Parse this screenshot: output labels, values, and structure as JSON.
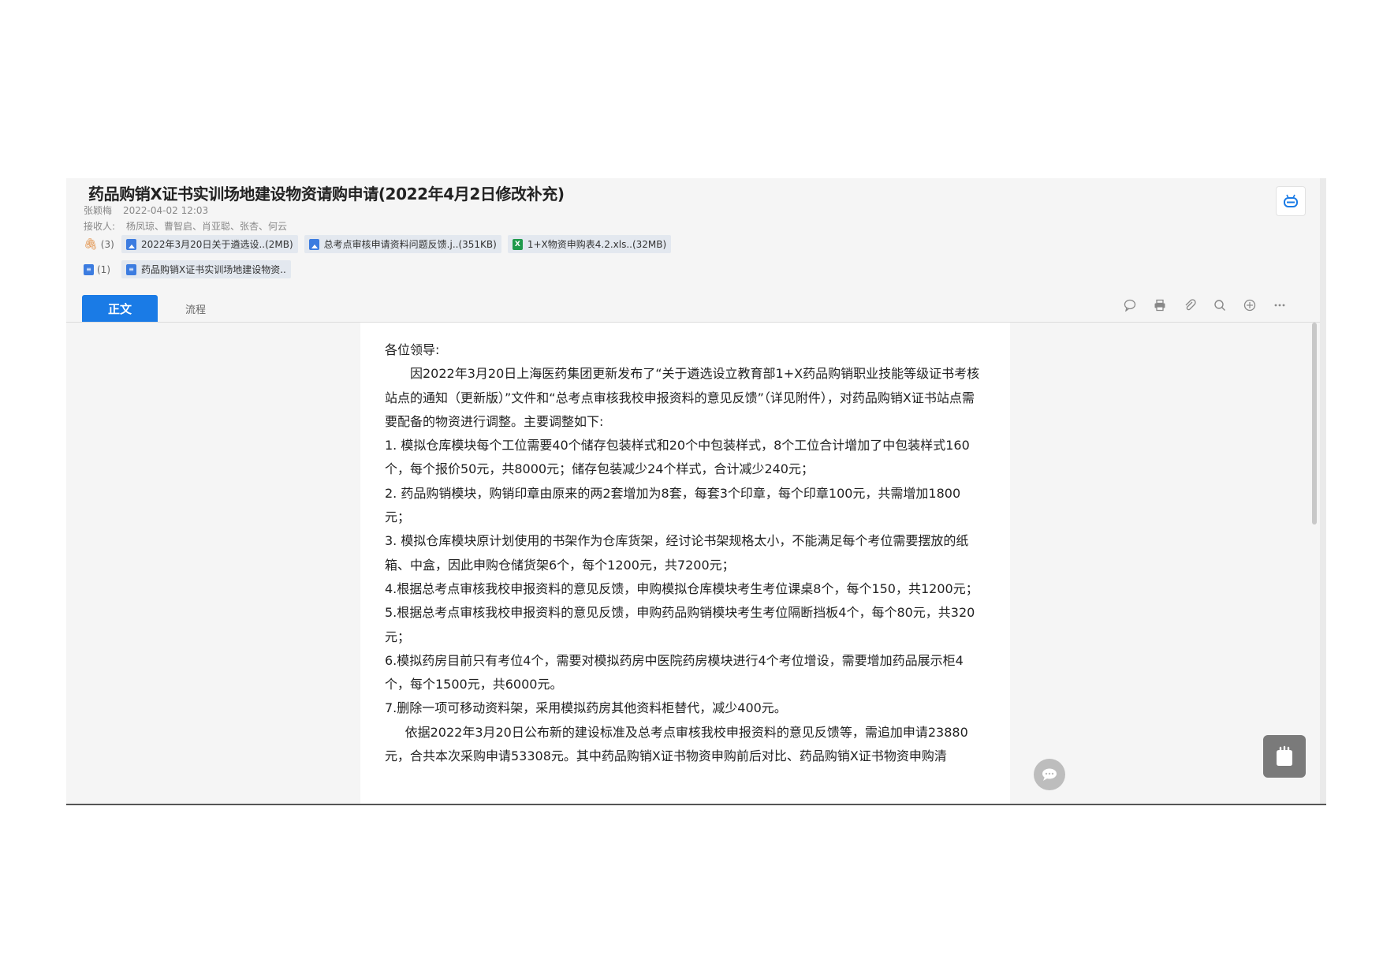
{
  "doc": {
    "title": "药品购销X证书实训场地建设物资请购申请(2022年4月2日修改补充)",
    "author": "张颖梅",
    "datetime": "2022-04-02 12:03",
    "recipients_label": "接收人:",
    "recipients": "杨凤琼、曹智启、肖亚聪、张杏、何云"
  },
  "attachments": {
    "count": "(3)",
    "items": [
      {
        "name": "2022年3月20日关于遴选设..(2MB)",
        "icon": "image-file-icon"
      },
      {
        "name": "总考点审核申请资料问题反馈.j..(351KB)",
        "icon": "image-file-icon"
      },
      {
        "name": "1+X物资申购表4.2.xls..(32MB)",
        "icon": "excel-file-icon"
      }
    ]
  },
  "related": {
    "count": "(1)",
    "items": [
      {
        "name": "药品购销X证书实训场地建设物资..",
        "icon": "form-doc-icon"
      }
    ]
  },
  "tabs": [
    {
      "label": "正文",
      "active": true
    },
    {
      "label": "流程",
      "active": false
    }
  ],
  "toolbar": [
    "comment-icon",
    "print-icon",
    "attachment-icon",
    "search-icon",
    "translate-icon",
    "more-icon"
  ],
  "body": {
    "greeting": "各位领导:",
    "p1": "因2022年3月20日上海医药集团更新发布了“关于遴选设立教育部1+X药品购销职业技能等级证书考核站点的通知（更新版）”文件和“总考点审核我校申报资料的意见反馈”（详见附件），对药品购销X证书站点需要配备的物资进行调整。主要调整如下:",
    "items": [
      "1. 模拟仓库模块每个工位需要40个储存包装样式和20个中包装样式，8个工位合计增加了中包装样式160个，每个报价50元，共8000元；储存包装减少24个样式，合计减少240元；",
      "2. 药品购销模块，购销印章由原来的两2套增加为8套，每套3个印章，每个印章100元，共需增加1800元；",
      "3. 模拟仓库模块原计划使用的书架作为仓库货架，经讨论书架规格太小，不能满足每个考位需要摆放的纸箱、中盒，因此申购仓储货架6个，每个1200元，共7200元；",
      "4.根据总考点审核我校申报资料的意见反馈，申购模拟仓库模块考生考位课桌8个，每个150，共1200元；",
      "5.根据总考点审核我校申报资料的意见反馈，申购药品购销模块考生考位隔断挡板4个，每个80元，共320元；",
      "6.模拟药房目前只有考位4个，需要对模拟药房中医院药房模块进行4个考位增设，需要增加药品展示柜4个，每个1500元，共6000元。",
      "7.删除一项可移动资料架，采用模拟药房其他资料柜替代，减少400元。"
    ],
    "p_last": "依据2022年3月20日公布新的建设标准及总考点审核我校申报资料的意见反馈等，需追加申请23880元，合共本次采购申请53308元。其中药品购销X证书物资申购前后对比、药品购销X证书物资申购清"
  }
}
